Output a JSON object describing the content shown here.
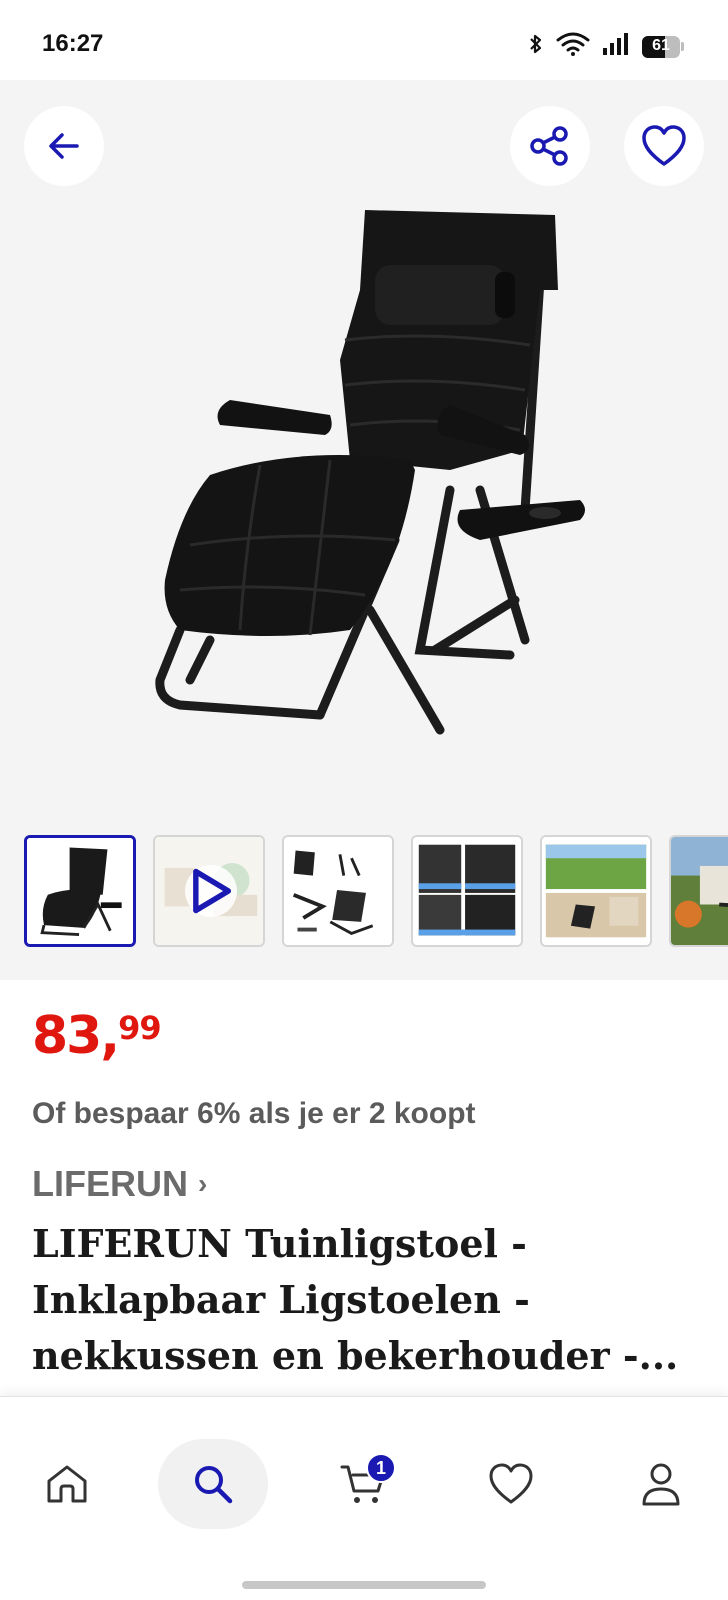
{
  "status_bar": {
    "time": "16:27",
    "battery_level": "61",
    "icons": [
      "bluetooth-icon",
      "wifi-icon",
      "signal-icon",
      "battery-icon"
    ]
  },
  "hero": {
    "buttons": [
      "back-arrow-icon",
      "share-icon",
      "heart-icon"
    ],
    "thumbnails": [
      {
        "name": "thumb-chair",
        "active": true
      },
      {
        "name": "thumb-video",
        "active": false
      },
      {
        "name": "thumb-dimensions",
        "active": false
      },
      {
        "name": "thumb-details",
        "active": false
      },
      {
        "name": "thumb-garden",
        "active": false
      },
      {
        "name": "thumb-terrace",
        "active": false
      }
    ]
  },
  "product": {
    "price_main": "83",
    "price_separator": ",",
    "price_cents": "99",
    "bundle_offer": "Of bespaar 6% als je er 2 koopt",
    "brand": "LIFERUN",
    "brand_chevron": "›",
    "title": "LIFERUN Tuinligstoel - Inklapbaar Ligstoelen - nekkussen en bekerhouder -..."
  },
  "bottom_nav": {
    "items": [
      "home-icon",
      "search-icon",
      "cart-icon",
      "heart-icon",
      "account-icon"
    ],
    "active": "search-icon",
    "cart_count": "1"
  },
  "colors": {
    "accent": "#1a1ab2",
    "price": "#e0170f",
    "hero_bg": "#f4f4f4"
  }
}
